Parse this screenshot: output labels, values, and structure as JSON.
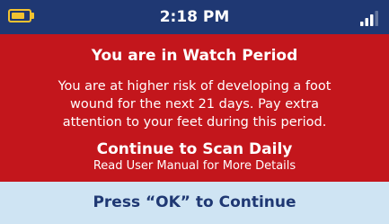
{
  "status_bar": {
    "time": "2:18 PM",
    "battery_level": 0.75,
    "signal_bars": 3,
    "battery_icon": "battery-icon",
    "signal_icon": "signal-strength-icon"
  },
  "alert": {
    "title": "You are in Watch Period",
    "body_lines": [
      "You are at higher risk of developing a foot",
      "wound for the next 21 days. Pay extra",
      "attention to your feet during this period."
    ],
    "action": "Continue to Scan Daily",
    "note": "Read User Manual for More Details"
  },
  "footer": {
    "prompt": "Press “OK” to Continue"
  },
  "colors": {
    "status_bar": "#1f3873",
    "alert_background": "#c3161c",
    "footer_background": "#cfe4f3",
    "battery": "#f2c230",
    "text_light": "#ffffff",
    "text_dark": "#1f3873"
  }
}
